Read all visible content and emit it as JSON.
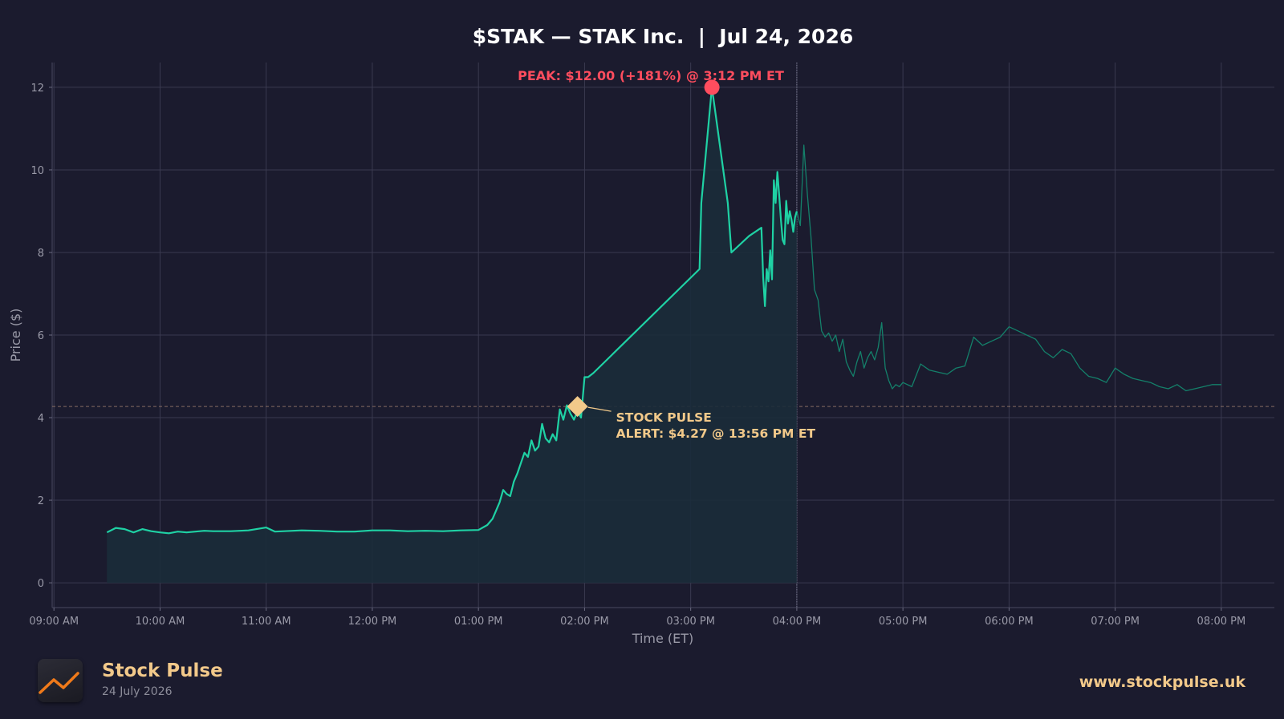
{
  "colors": {
    "background": "#1b1b2e",
    "line": "#1fd1a4",
    "line_after_hours": "#14806a",
    "area_fill": "#1b2c3a",
    "peak": "#ff4d5e",
    "alert": "#f2c98a",
    "grid": "#3a3a50",
    "axis_text": "#9a9aa8"
  },
  "chart_data": {
    "type": "line",
    "title": "$STAK — STAK Inc.  |  Jul 24, 2026",
    "xlabel": "Time (ET)",
    "ylabel": "Price ($)",
    "ylim": [
      -0.6,
      12.6
    ],
    "xlim": [
      "08:59",
      "20:30"
    ],
    "x_ticks": [
      "09:00 AM",
      "10:00 AM",
      "11:00 AM",
      "12:00 PM",
      "01:00 PM",
      "02:00 PM",
      "03:00 PM",
      "04:00 PM",
      "05:00 PM",
      "06:00 PM",
      "07:00 PM",
      "08:00 PM"
    ],
    "y_ticks": [
      "0",
      "2",
      "4",
      "6",
      "8",
      "10",
      "12"
    ],
    "grid": true,
    "market_close": "16:00",
    "alert_level": 4.27,
    "series": [
      {
        "segment": "market-hours",
        "x": [
          "09:30",
          "09:35",
          "09:40",
          "09:45",
          "09:50",
          "09:55",
          "10:00",
          "10:05",
          "10:10",
          "10:15",
          "10:20",
          "10:25",
          "10:30",
          "10:40",
          "10:50",
          "11:00",
          "11:05",
          "11:10",
          "11:20",
          "11:30",
          "11:40",
          "11:50",
          "12:00",
          "12:10",
          "12:20",
          "12:30",
          "12:40",
          "12:50",
          "13:00",
          "13:05",
          "13:08",
          "13:10",
          "13:12",
          "13:14",
          "13:16",
          "13:18",
          "13:20",
          "13:22",
          "13:24",
          "13:26",
          "13:28",
          "13:30",
          "13:32",
          "13:34",
          "13:36",
          "13:38",
          "13:40",
          "13:42",
          "13:44",
          "13:46",
          "13:48",
          "13:50",
          "13:52",
          "13:54",
          "13:56",
          "13:58",
          "14:00",
          "14:02",
          "14:05",
          "15:05",
          "15:06",
          "15:12",
          "15:21",
          "15:23",
          "15:33",
          "15:40",
          "15:41",
          "15:42",
          "15:43",
          "15:44",
          "15:45",
          "15:46",
          "15:47",
          "15:48",
          "15:49",
          "15:50",
          "15:51",
          "15:52",
          "15:53",
          "15:54",
          "15:55",
          "15:56",
          "15:57",
          "15:58",
          "15:59",
          "16:00"
        ],
        "values": [
          1.22,
          1.33,
          1.3,
          1.22,
          1.3,
          1.25,
          1.22,
          1.2,
          1.24,
          1.22,
          1.24,
          1.26,
          1.25,
          1.25,
          1.27,
          1.34,
          1.24,
          1.25,
          1.27,
          1.26,
          1.24,
          1.24,
          1.27,
          1.27,
          1.25,
          1.26,
          1.25,
          1.27,
          1.28,
          1.4,
          1.55,
          1.75,
          1.95,
          2.25,
          2.15,
          2.1,
          2.45,
          2.65,
          2.9,
          3.15,
          3.05,
          3.45,
          3.2,
          3.3,
          3.85,
          3.5,
          3.4,
          3.6,
          3.45,
          4.2,
          3.95,
          4.3,
          4.1,
          3.95,
          4.15,
          4.0,
          4.98,
          4.98,
          5.08,
          7.6,
          9.2,
          12.0,
          9.2,
          8.0,
          8.4,
          8.6,
          7.4,
          6.7,
          7.6,
          7.3,
          8.05,
          7.35,
          9.75,
          9.2,
          9.95,
          9.4,
          8.8,
          8.3,
          8.2,
          9.25,
          8.7,
          9.0,
          8.8,
          8.5,
          8.85,
          9.0
        ]
      },
      {
        "segment": "after-hours",
        "x": [
          "16:00",
          "16:02",
          "16:04",
          "16:06",
          "16:08",
          "16:10",
          "16:12",
          "16:14",
          "16:16",
          "16:18",
          "16:20",
          "16:22",
          "16:24",
          "16:26",
          "16:28",
          "16:30",
          "16:32",
          "16:34",
          "16:36",
          "16:38",
          "16:40",
          "16:42",
          "16:44",
          "16:46",
          "16:48",
          "16:50",
          "16:52",
          "16:54",
          "16:56",
          "16:58",
          "17:00",
          "17:05",
          "17:10",
          "17:15",
          "17:20",
          "17:25",
          "17:30",
          "17:35",
          "17:40",
          "17:45",
          "17:50",
          "17:55",
          "18:00",
          "18:05",
          "18:10",
          "18:15",
          "18:20",
          "18:25",
          "18:30",
          "18:35",
          "18:40",
          "18:45",
          "18:50",
          "18:55",
          "19:00",
          "19:05",
          "19:10",
          "19:15",
          "19:20",
          "19:25",
          "19:30",
          "19:35",
          "19:40",
          "19:45",
          "19:50",
          "19:55",
          "20:00"
        ],
        "values": [
          9.0,
          8.65,
          10.6,
          9.4,
          8.4,
          7.1,
          6.85,
          6.1,
          5.95,
          6.05,
          5.85,
          6.0,
          5.6,
          5.9,
          5.35,
          5.15,
          5.0,
          5.35,
          5.6,
          5.2,
          5.45,
          5.6,
          5.4,
          5.7,
          6.3,
          5.2,
          4.9,
          4.7,
          4.8,
          4.75,
          4.85,
          4.75,
          5.3,
          5.15,
          5.1,
          5.05,
          5.2,
          5.25,
          5.95,
          5.75,
          5.85,
          5.95,
          6.2,
          6.1,
          6.0,
          5.9,
          5.6,
          5.45,
          5.65,
          5.55,
          5.2,
          5.0,
          4.95,
          4.85,
          5.2,
          5.05,
          4.95,
          4.9,
          4.85,
          4.75,
          4.7,
          4.8,
          4.65,
          4.7,
          4.75,
          4.8,
          4.8
        ]
      }
    ],
    "annotations": {
      "peak_label": "PEAK: $12.00 (+181%) @ 3:12 PM ET",
      "peak_x": "15:12",
      "peak_y": 12.0,
      "alert_label_line1": "STOCK PULSE",
      "alert_label_line2": "ALERT: $4.27 @ 13:56 PM ET",
      "alert_x": "13:56",
      "alert_y": 4.27
    }
  },
  "footer": {
    "brand": "Stock Pulse",
    "date": "24 July 2026",
    "website": "www.stockpulse.uk",
    "logo_icon": "trend-chart-icon"
  }
}
